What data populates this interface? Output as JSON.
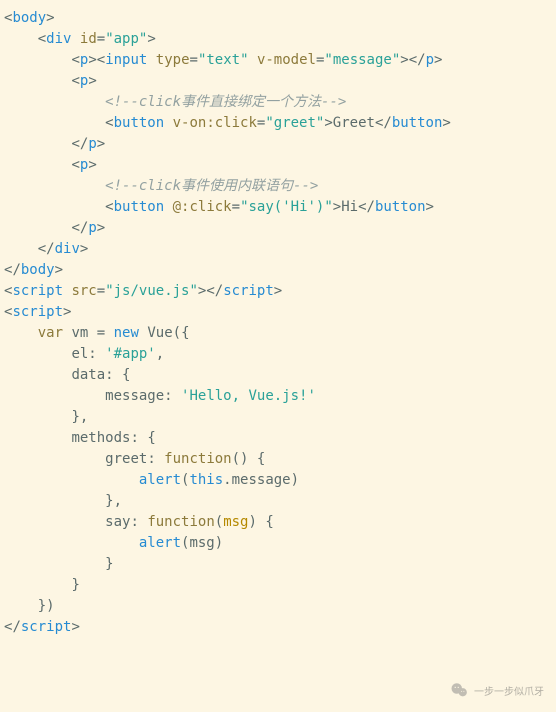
{
  "code": {
    "tag_body": "body",
    "tag_div": "div",
    "attr_id": "id",
    "val_app": "\"app\"",
    "tag_p": "p",
    "tag_input": "input",
    "attr_type": "type",
    "val_text": "\"text\"",
    "attr_vmodel": "v-model",
    "val_message": "\"message\"",
    "comment1": "<!--click事件直接绑定一个方法-->",
    "tag_button": "button",
    "attr_von_click": "v-on:click",
    "val_greet": "\"greet\"",
    "txt_greet": "Greet",
    "comment2": "<!--click事件使用内联语句-->",
    "attr_at_click": "@:click",
    "val_say_hi": "\"say('Hi')\"",
    "txt_hi": "Hi",
    "tag_script": "script",
    "attr_src": "src",
    "val_src": "\"js/vue.js\"",
    "kw_var": "var",
    "id_vm": "vm",
    "op_eq": " = ",
    "kw_new": "new",
    "id_vue": "Vue",
    "lparen": "(",
    "lbrace": "{",
    "rbrace": "}",
    "rparen": ")",
    "key_el": "el",
    "val_el": "'#app'",
    "key_data": "data",
    "key_message": "message",
    "val_msg_str": "'Hello, Vue.js!'",
    "key_methods": "methods",
    "key_greet": "greet",
    "kw_function": "function",
    "call_alert": "alert",
    "kw_this": "this",
    "dot_message": ".message",
    "key_say": "say",
    "param_msg": "msg",
    "colon": ": ",
    "comma": ",",
    "lt": "<",
    "gt": ">",
    "sl": "/",
    "eqs": "="
  },
  "watermark": "一步一步似爪牙"
}
